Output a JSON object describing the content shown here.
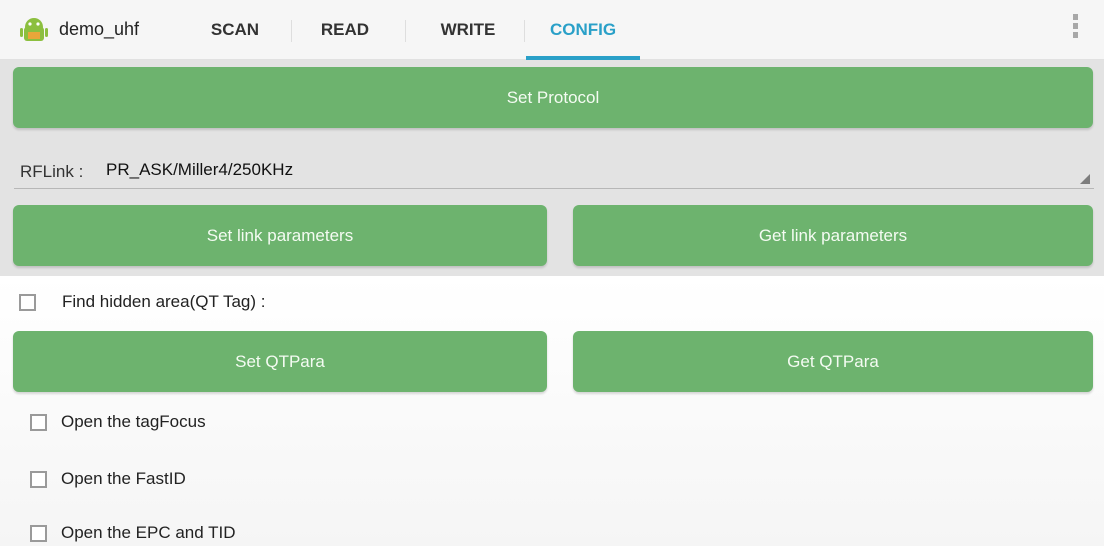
{
  "header": {
    "app_title": "demo_uhf",
    "tabs": [
      {
        "label": "SCAN"
      },
      {
        "label": "READ"
      },
      {
        "label": "WRITE"
      },
      {
        "label": "CONFIG"
      }
    ],
    "active_tab": "CONFIG",
    "accent_color": "#2aa0c8"
  },
  "config": {
    "set_protocol_label": "Set Protocol",
    "rflink": {
      "label": "RFLink :",
      "selected_value": "PR_ASK/Miller4/250KHz"
    },
    "set_link_label": "Set link parameters",
    "get_link_label": "Get link parameters",
    "find_hidden_label": "Find hidden area(QT Tag) :",
    "set_qt_label": "Set QTPara",
    "get_qt_label": "Get QTPara",
    "options": [
      {
        "label": "Open the tagFocus",
        "checked": false
      },
      {
        "label": "Open the FastID",
        "checked": false
      },
      {
        "label": "Open the EPC and TID",
        "checked": false
      }
    ],
    "button_color": "#6db36e"
  }
}
